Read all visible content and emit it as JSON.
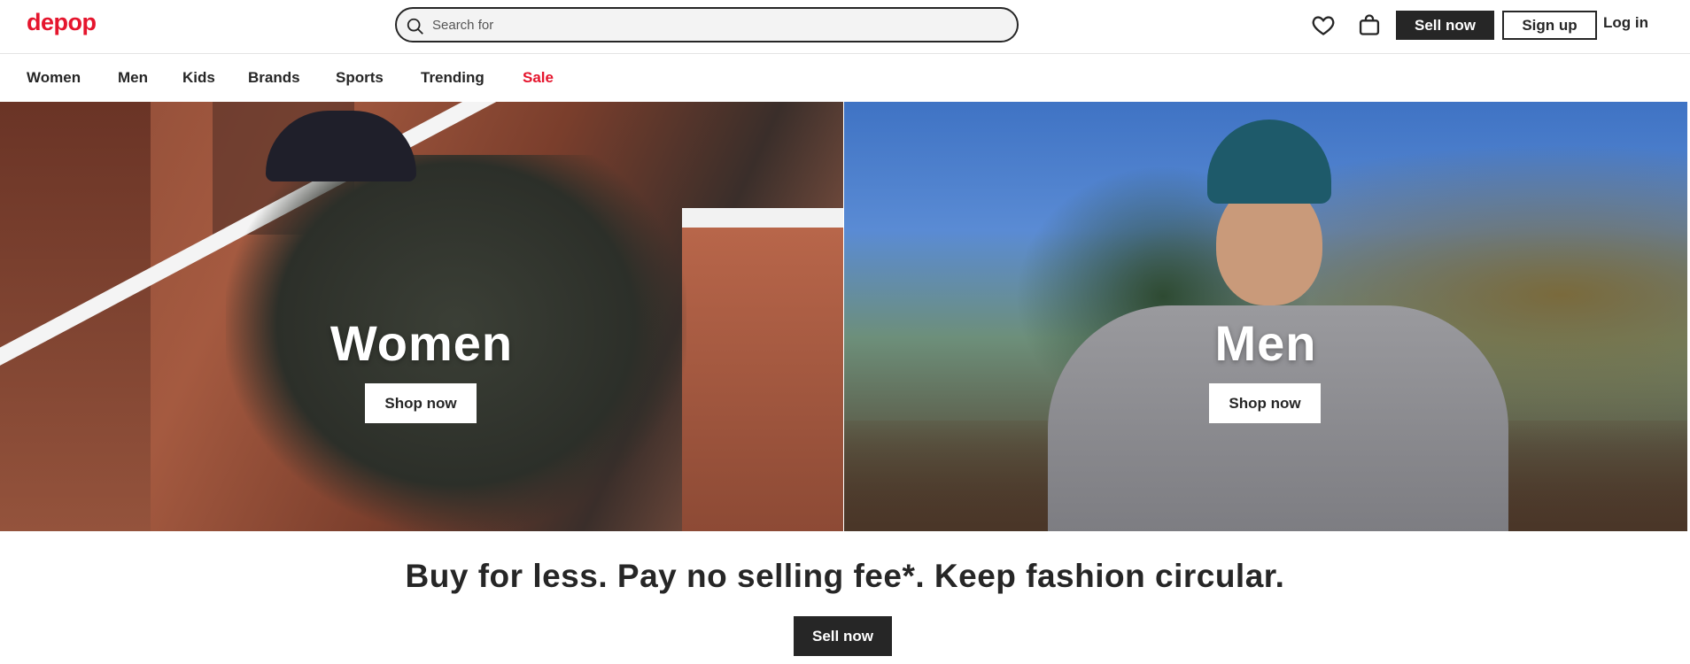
{
  "brand": {
    "logo_text": "depop",
    "accent_color": "#e5152d"
  },
  "header": {
    "search": {
      "placeholder": "Search for",
      "value": ""
    },
    "icons": [
      "heart-icon",
      "shopping-bag-icon",
      "search-icon"
    ],
    "sell_label": "Sell now",
    "signup_label": "Sign up",
    "login_label": "Log in"
  },
  "nav": {
    "items": [
      {
        "label": "Women"
      },
      {
        "label": "Men"
      },
      {
        "label": "Kids"
      },
      {
        "label": "Brands"
      },
      {
        "label": "Sports"
      },
      {
        "label": "Trending"
      },
      {
        "label": "Sale"
      }
    ]
  },
  "hero": {
    "women": {
      "title": "Women",
      "button": "Shop now"
    },
    "men": {
      "title": "Men",
      "button": "Shop now"
    }
  },
  "promo": {
    "tagline": "Buy for less. Pay no selling fee*. Keep fashion circular.",
    "button": "Sell now"
  }
}
